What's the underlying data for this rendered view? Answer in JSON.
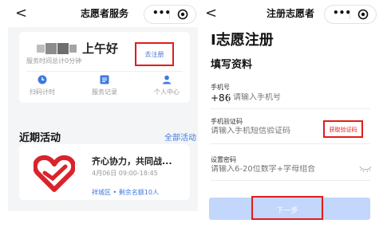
{
  "left": {
    "nav": {
      "back": "<",
      "title": "志愿者服务",
      "more": "•••"
    },
    "profile": {
      "greeting": "上午好",
      "service_time": "服务时间总计0分钟",
      "register_btn": "去注册"
    },
    "actions": [
      {
        "label": "扫码计时",
        "icon": "clock-icon"
      },
      {
        "label": "服务记录",
        "icon": "list-icon"
      },
      {
        "label": "个人中心",
        "icon": "user-icon"
      }
    ],
    "recent": {
      "title": "近期活动",
      "all": "全部活动",
      "activity": {
        "title": "齐心协力，共同战...",
        "time": "4月06日 09:00-18:45",
        "meta": "祥城区 • 剩余名额10人"
      }
    }
  },
  "right": {
    "nav": {
      "back": "<",
      "title": "注册志愿者",
      "more": "•••"
    },
    "page_title": "I志愿注册",
    "section_title": "填写资料",
    "phone": {
      "label": "手机号",
      "prefix": "+86",
      "placeholder": "请输入手机号"
    },
    "code": {
      "label": "手机验证码",
      "placeholder": "请输入手机短信验证码",
      "button": "获取验证码"
    },
    "password": {
      "label": "设置密码",
      "placeholder": "请输入6-20位数字+字母组合"
    },
    "next_btn": "下一步"
  },
  "colors": {
    "accent_blue": "#3f78e0",
    "highlight_red": "#e21c1c",
    "disabled_button": "#c3d6fb",
    "logo_red": "#d9232d"
  }
}
